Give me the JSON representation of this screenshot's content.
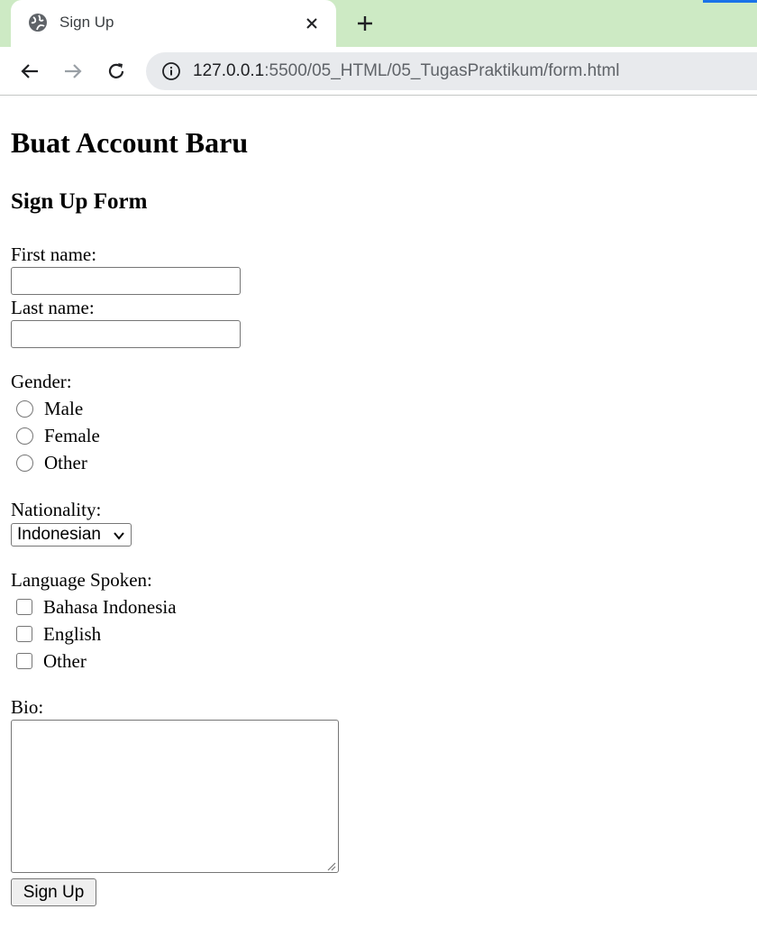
{
  "browser": {
    "tab": {
      "title": "Sign Up",
      "favicon": "globe-icon"
    },
    "close_icon": "close-icon",
    "new_tab_icon": "plus-icon",
    "nav": {
      "back": "back-arrow-icon",
      "forward": "forward-arrow-icon",
      "reload": "reload-icon"
    },
    "url": {
      "host": "127.0.0.1",
      "path": ":5500/05_HTML/05_TugasPraktikum/form.html"
    },
    "colors": {
      "tabbar": "#cdeac4",
      "omnibox": "#e8eaed",
      "accent": "#1a73e8"
    }
  },
  "page": {
    "heading": "Buat Account Baru",
    "subheading": "Sign Up Form",
    "first_name": {
      "label": "First name:",
      "value": ""
    },
    "last_name": {
      "label": "Last name:",
      "value": ""
    },
    "gender": {
      "label": "Gender:",
      "options": [
        "Male",
        "Female",
        "Other"
      ]
    },
    "nationality": {
      "label": "Nationality:",
      "selected": "Indonesian"
    },
    "languages": {
      "label": "Language Spoken:",
      "options": [
        "Bahasa Indonesia",
        "English",
        "Other"
      ]
    },
    "bio": {
      "label": "Bio:",
      "value": ""
    },
    "submit_label": "Sign Up"
  }
}
